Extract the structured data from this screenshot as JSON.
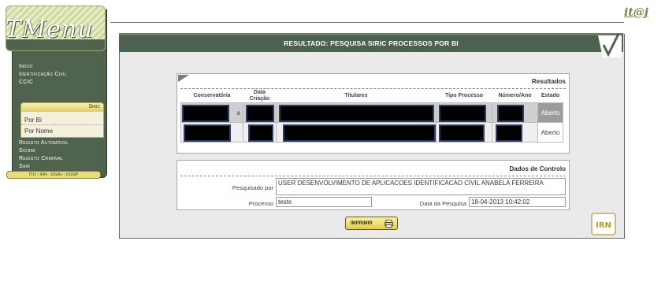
{
  "brand": {
    "logo_text": "TMenu",
    "corner_link": "it@j"
  },
  "sidebar": {
    "items_top": [
      "Início",
      "Identificação Civil",
      "CCIC"
    ],
    "siric": {
      "label": "Siric",
      "sub_items": [
        "Por Bi",
        "Por Nome"
      ]
    },
    "items_bottom": [
      "Registo Automóvel",
      "Sicrim",
      "Registo Criminal",
      "Sair"
    ],
    "footer": "ITIJ : IRN : DGAJ : DGSP"
  },
  "header": {
    "title": "RESULTADO: PESQUISA SIRIC PROCESSOS POR BI"
  },
  "results": {
    "title": "Resultados",
    "columns": [
      "Conservatória",
      "Data\nCriação",
      "Titulares",
      "Tipo Processo",
      "Número/Ano",
      "Estado"
    ],
    "rows": [
      {
        "conservatoria_tail": "a",
        "estado": "Aberto"
      },
      {
        "estado": "Aberto"
      }
    ]
  },
  "control": {
    "title": "Dados de Controlo",
    "pesquisado_por_label": "Pesquisado por",
    "pesquisado_por_value": "USER DESENVOLVIMENTO DE APLICACOES IDENTIFICACAO CIVIL ANABELA FERREIRA",
    "processo_label": "Processo",
    "processo_value": "teste",
    "data_label": "Data da Pesquisa",
    "data_value": "18-04-2013 10:42:02"
  },
  "footer": {
    "print_label": "IMPRIMIR",
    "logo_text": "IRN"
  },
  "colors": {
    "sidebar_bg": "#50634f",
    "title_bar": "#4d6150",
    "accent_gold": "#e3cd4d",
    "panel_bg": "#eaeaea"
  }
}
